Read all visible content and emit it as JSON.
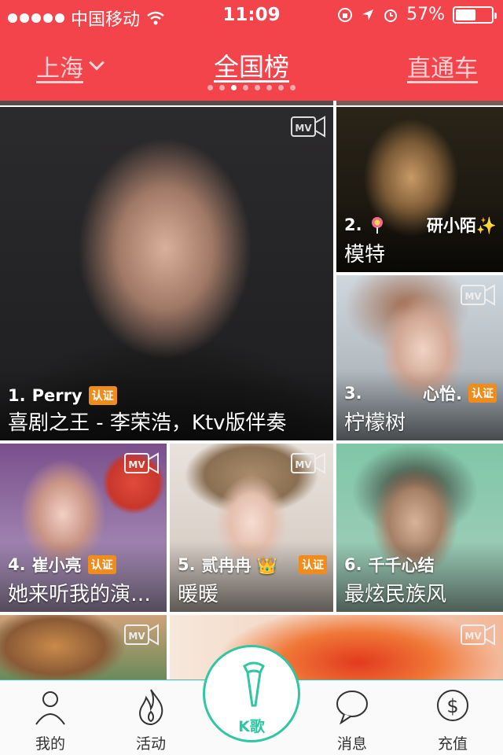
{
  "status_bar": {
    "carrier": "中国移动",
    "time": "11:09",
    "battery": "57%",
    "battery_level": 0.57
  },
  "nav": {
    "city": "上海",
    "title": "全国榜",
    "right_link": "直通车",
    "page_count": 8,
    "active_page": 2
  },
  "tiles": [
    {
      "rank": "1.",
      "name": "Perry",
      "badge": "认证",
      "song": "喜剧之王 - 李荣浩，Ktv版伴奏"
    },
    {
      "rank": "2.",
      "name": "研小陌✨",
      "badge": "",
      "song": "模特"
    },
    {
      "rank": "3.",
      "name": "心怡.",
      "badge": "认证",
      "song": "柠檬树"
    },
    {
      "rank": "4.",
      "name": "崔小亮",
      "badge": "认证",
      "song": "她来听我的演…"
    },
    {
      "rank": "5.",
      "name": "贰冉冉 👑",
      "badge": "认证",
      "song": "暖暖"
    },
    {
      "rank": "6.",
      "name": "千千心结",
      "badge": "",
      "song": "最炫民族风"
    }
  ],
  "mv_label": "MV",
  "tabbar": {
    "tabs": [
      {
        "label": "我的"
      },
      {
        "label": "活动"
      },
      {
        "label": "K歌"
      },
      {
        "label": "消息"
      },
      {
        "label": "充值"
      }
    ]
  },
  "colors": {
    "header": "#f3444c",
    "accent": "#2fc7a3",
    "badge": "#f08c1c"
  }
}
